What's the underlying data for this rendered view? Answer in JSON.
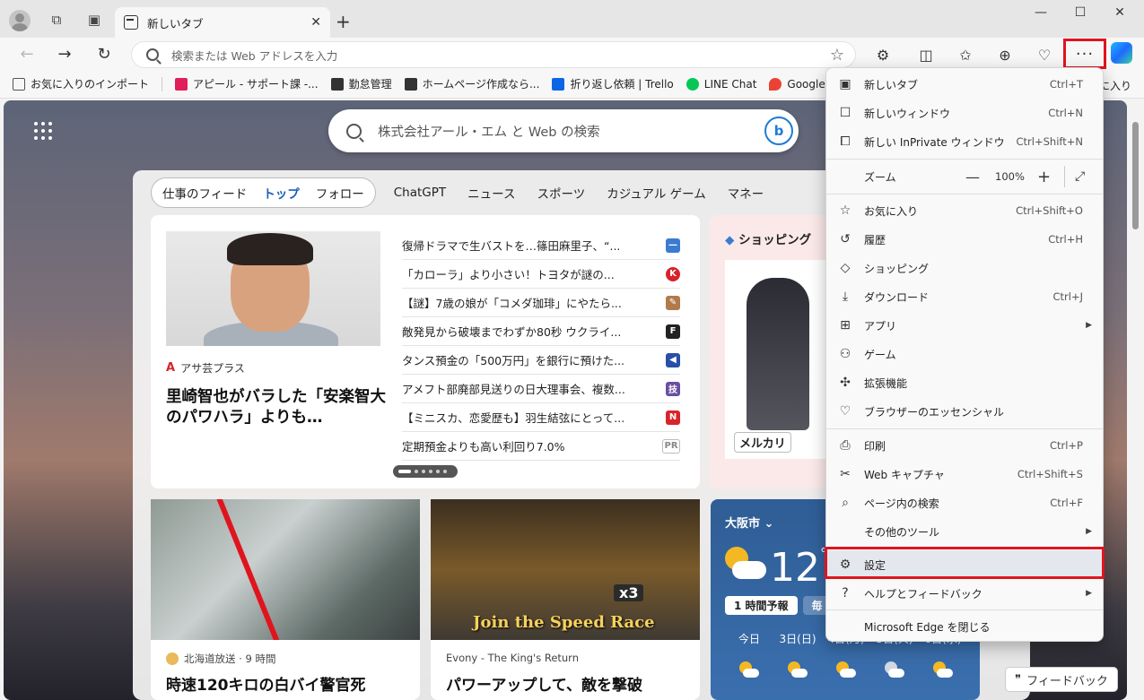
{
  "tab": {
    "title": "新しいタブ"
  },
  "address_bar": {
    "placeholder": "検索または Web アドレスを入力"
  },
  "favorites": [
    {
      "label": "お気に入りのインポート",
      "color": "#555555"
    },
    {
      "label": "アピール - サポート課 -...",
      "color": "#e01e5a"
    },
    {
      "label": "勤怠管理",
      "color": "#333333"
    },
    {
      "label": "ホームページ作成なら...",
      "color": "#333333"
    },
    {
      "label": "折り返し依頼 | Trello",
      "color": "#0c66e4"
    },
    {
      "label": "LINE Chat",
      "color": "#06c755"
    },
    {
      "label": "Google マップ",
      "color": "#ea4335"
    }
  ],
  "favorites_right": "に入り",
  "search": {
    "placeholder": "株式会社アール・エム と Web の検索"
  },
  "feed": {
    "pill_tabs": [
      "仕事のフィード",
      "トップ",
      "フォロー"
    ],
    "nav": [
      "ChatGPT",
      "ニュース",
      "スポーツ",
      "カジュアル ゲーム",
      "マネー"
    ]
  },
  "hero": {
    "source": "アサ芸プラス",
    "title": "里崎智也がバラした「安楽智大のパワハラ」よりも…"
  },
  "news": [
    {
      "text": "復帰ドラマで生バストを…篠田麻里子、“...",
      "badge": "—",
      "color": "#3b7bd1"
    },
    {
      "text": "「カローラ」より小さい！トヨタが謎の...",
      "badge": "K",
      "color": "#d8232a"
    },
    {
      "text": "【謎】7歳の娘が「コメダ珈琲」にやたら...",
      "badge": "✎",
      "color": "#b07a4a"
    },
    {
      "text": "敵発見から破壊までわずか80秒 ウクライ...",
      "badge": "F",
      "color": "#222222"
    },
    {
      "text": "タンス預金の「500万円」を銀行に預けた...",
      "badge": "◀",
      "color": "#2a4fa8"
    },
    {
      "text": "アメフト部廃部見送りの日大理事会、複数...",
      "badge": "技",
      "color": "#6a4fa0"
    },
    {
      "text": "【ミニスカ、恋愛歴も】羽生結弦にとって...",
      "badge": "N",
      "color": "#d8232a"
    },
    {
      "text": "定期預金よりも高い利回り7.0%",
      "badge": "PR",
      "color": "#888888"
    }
  ],
  "shopping": {
    "title": "ショッピング",
    "brand": "メルカリ"
  },
  "card1": {
    "source": "北海道放送 · 9 時間",
    "title": "時速120キロの白バイ警官死"
  },
  "card2": {
    "source": "Evony - The King's Return",
    "title": "パワーアップして、敵を撃破",
    "art_text": "Join the Speed Race",
    "art_badge": "x3"
  },
  "weather": {
    "city": "大阪市",
    "temp": "12",
    "unit": "°",
    "tabs": [
      "1 時間予報",
      "毎"
    ],
    "days": [
      "今日",
      "3日(日)",
      "4日(月)",
      "5日(火)",
      "6日(水)"
    ]
  },
  "feedback": "フィードバック",
  "menu": {
    "items": [
      {
        "icon": "new-tab-icon",
        "label": "新しいタブ",
        "shortcut": "Ctrl+T"
      },
      {
        "icon": "new-window-icon",
        "label": "新しいウィンドウ",
        "shortcut": "Ctrl+N"
      },
      {
        "icon": "inprivate-icon",
        "label": "新しい InPrivate ウィンドウ",
        "shortcut": "Ctrl+Shift+N"
      },
      {
        "icon": "favorites-icon",
        "label": "お気に入り",
        "shortcut": "Ctrl+Shift+O"
      },
      {
        "icon": "history-icon",
        "label": "履歴",
        "shortcut": "Ctrl+H"
      },
      {
        "icon": "shopping-icon",
        "label": "ショッピング",
        "shortcut": ""
      },
      {
        "icon": "download-icon",
        "label": "ダウンロード",
        "shortcut": "Ctrl+J"
      },
      {
        "icon": "apps-icon",
        "label": "アプリ",
        "shortcut": ""
      },
      {
        "icon": "games-icon",
        "label": "ゲーム",
        "shortcut": ""
      },
      {
        "icon": "extensions-icon",
        "label": "拡張機能",
        "shortcut": ""
      },
      {
        "icon": "essentials-icon",
        "label": "ブラウザーのエッセンシャル",
        "shortcut": ""
      },
      {
        "icon": "print-icon",
        "label": "印刷",
        "shortcut": "Ctrl+P"
      },
      {
        "icon": "web-capture-icon",
        "label": "Web キャプチャ",
        "shortcut": "Ctrl+Shift+S"
      },
      {
        "icon": "find-icon",
        "label": "ページ内の検索",
        "shortcut": "Ctrl+F"
      },
      {
        "icon": "",
        "label": "その他のツール",
        "shortcut": ""
      },
      {
        "icon": "gear-icon",
        "label": "設定",
        "shortcut": ""
      },
      {
        "icon": "help-icon",
        "label": "ヘルプとフィードバック",
        "shortcut": ""
      },
      {
        "icon": "",
        "label": "Microsoft Edge を閉じる",
        "shortcut": ""
      }
    ],
    "zoom_label": "ズーム",
    "zoom_value": "100%",
    "highlight_color": "#e0141e"
  }
}
